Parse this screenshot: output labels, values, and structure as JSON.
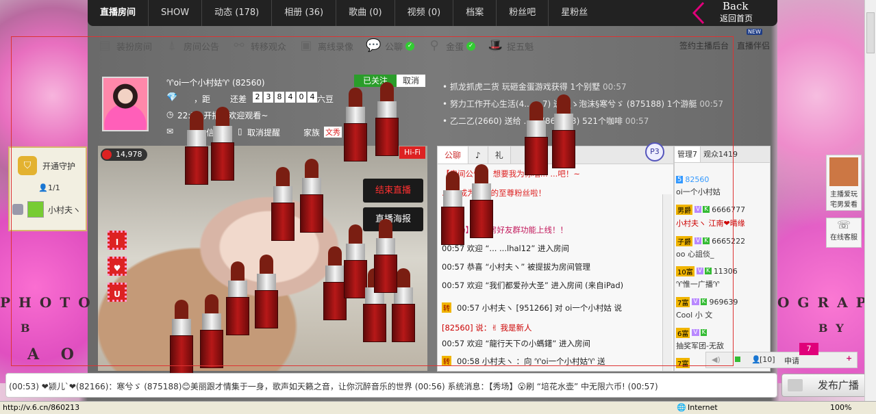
{
  "nav": {
    "items": [
      "直播房间",
      "SHOW",
      "动态 (178)",
      "相册 (36)",
      "歌曲 (0)",
      "视频 (0)",
      "档案",
      "粉丝吧",
      "星粉丝"
    ],
    "back_label": "Back",
    "back_sub": "返回首页"
  },
  "toolbar": {
    "items": [
      "装扮房间",
      "房间公告",
      "转移观众",
      "离线录像",
      "公聊",
      "金蛋",
      "捉五魁"
    ],
    "sign": "签约主播后台",
    "partner": "直播伴侣",
    "new_badge": "NEW"
  },
  "guard": {
    "title": "开通守护",
    "count": "1/1",
    "member": "小村夫ヽ"
  },
  "anchor": {
    "name": "♈οi一个小村姑♈ (82560)",
    "follow": "已关注",
    "cancel": "取消",
    "distance_prefix": "，距",
    "still_short": "还差",
    "digits": [
      "2",
      "3",
      "8",
      "4",
      "0",
      "4"
    ],
    "beans": "六豆",
    "time_line": "22:57 开播，欢迎观看~",
    "msg_line": "信",
    "cancel_remind": "取消提醒",
    "family": "家族",
    "family_tag": "文秀"
  },
  "video": {
    "wealth": "14,978",
    "hifi": "Hi-Fi",
    "end_live": "结束直播",
    "poster": "直播海报",
    "hearts": [
      "I",
      "♥",
      "U"
    ]
  },
  "notices": [
    {
      "text": "抓龙抓虎二货 玩砸金蛋游戏获得 1个别墅",
      "time": "00:57"
    },
    {
      "text": "努力工作开心生活(4... ...7) 送 ▁ゝ泡沫§寒兮ゞ (875188) 1个游艇",
      "time": "00:57"
    },
    {
      "text": "乙二乙(2660) 送给 ... ...(860213) 521个咖啡",
      "time": "00:57"
    }
  ],
  "chat": {
    "tabs": [
      "公聊",
      "♪",
      "礼"
    ],
    "p_badge": "P3",
    "lines": [
      "【房间公告】：想要我为你唱... ...吧！~",
      "... ...成为最新的至尊粉丝啦！",
      "【秀场】六间房好友群功能上线！！",
      "00:57 欢迎 “... ...lhal12” 进入房间",
      "00:57 恭喜 “小村夫ヽ” 被提拔为房间管理",
      "00:57 欢迎 “我们都爱孙大圣” 进入房间 (来自iPad)",
      "00:57 小村夫ヽ [951266] 对 οi一个小村姑 说",
      "[82560] 说：✌ 我是新人",
      "00:57 欢迎 “龍行天下の小螞鐯” 进入房间",
      "00:58 小村夫ヽ ：向 ♈οi一个小村姑♈ 送"
    ],
    "tag_zhuan": "转"
  },
  "users": {
    "tabs": [
      "管理7",
      "观众1419"
    ],
    "rows": [
      {
        "level": "5",
        "id": "82560",
        "name": "οi一个小村姑"
      },
      {
        "level": "男爵",
        "id": "6666777",
        "name": "小村夫ヽ 江南❤晴缘"
      },
      {
        "level": "子爵",
        "id": "6665222",
        "name": "οo 心詛倓_"
      },
      {
        "level": "10富",
        "id": "11306",
        "name": "♈惟一广播♈"
      },
      {
        "level": "7富",
        "id": "969639",
        "name": "Cool 小 文"
      },
      {
        "level": "6富",
        "id": "",
        "name": "抽奖军团-无敌"
      },
      {
        "level": "7富",
        "id": "",
        "name": ""
      }
    ],
    "count": "[10]",
    "apply": "申请",
    "apply_badge": "7"
  },
  "side_right": {
    "anchor_play": "主播爱玩",
    "anchor_play2": "宅男爱看",
    "service": "在线客服"
  },
  "ticker": {
    "text": "(00:53)  ❤颍儿`❤(82166)：寒兮ゞ (875188)😊美丽跟才情集于一身，歌声如天籁之音，让你沉醉音乐的世界   (00:56)  系统消息：【秀场】😮刷 “培花水壶” 中无限六币!  (00:57)"
  },
  "broadcast_label": "发布广播",
  "status": {
    "url": "http://v.6.cn/860213",
    "zone": "Internet",
    "zoom": "100%"
  },
  "deco_text": {
    "left": "PHOTOG",
    "right": "OGRAPH",
    "b": "B",
    "y": "BY",
    "ao": "A O"
  },
  "colors": {
    "accent": "#e0007a",
    "follow_green": "#2a9d2a",
    "video_red_btn": "#d31010"
  }
}
